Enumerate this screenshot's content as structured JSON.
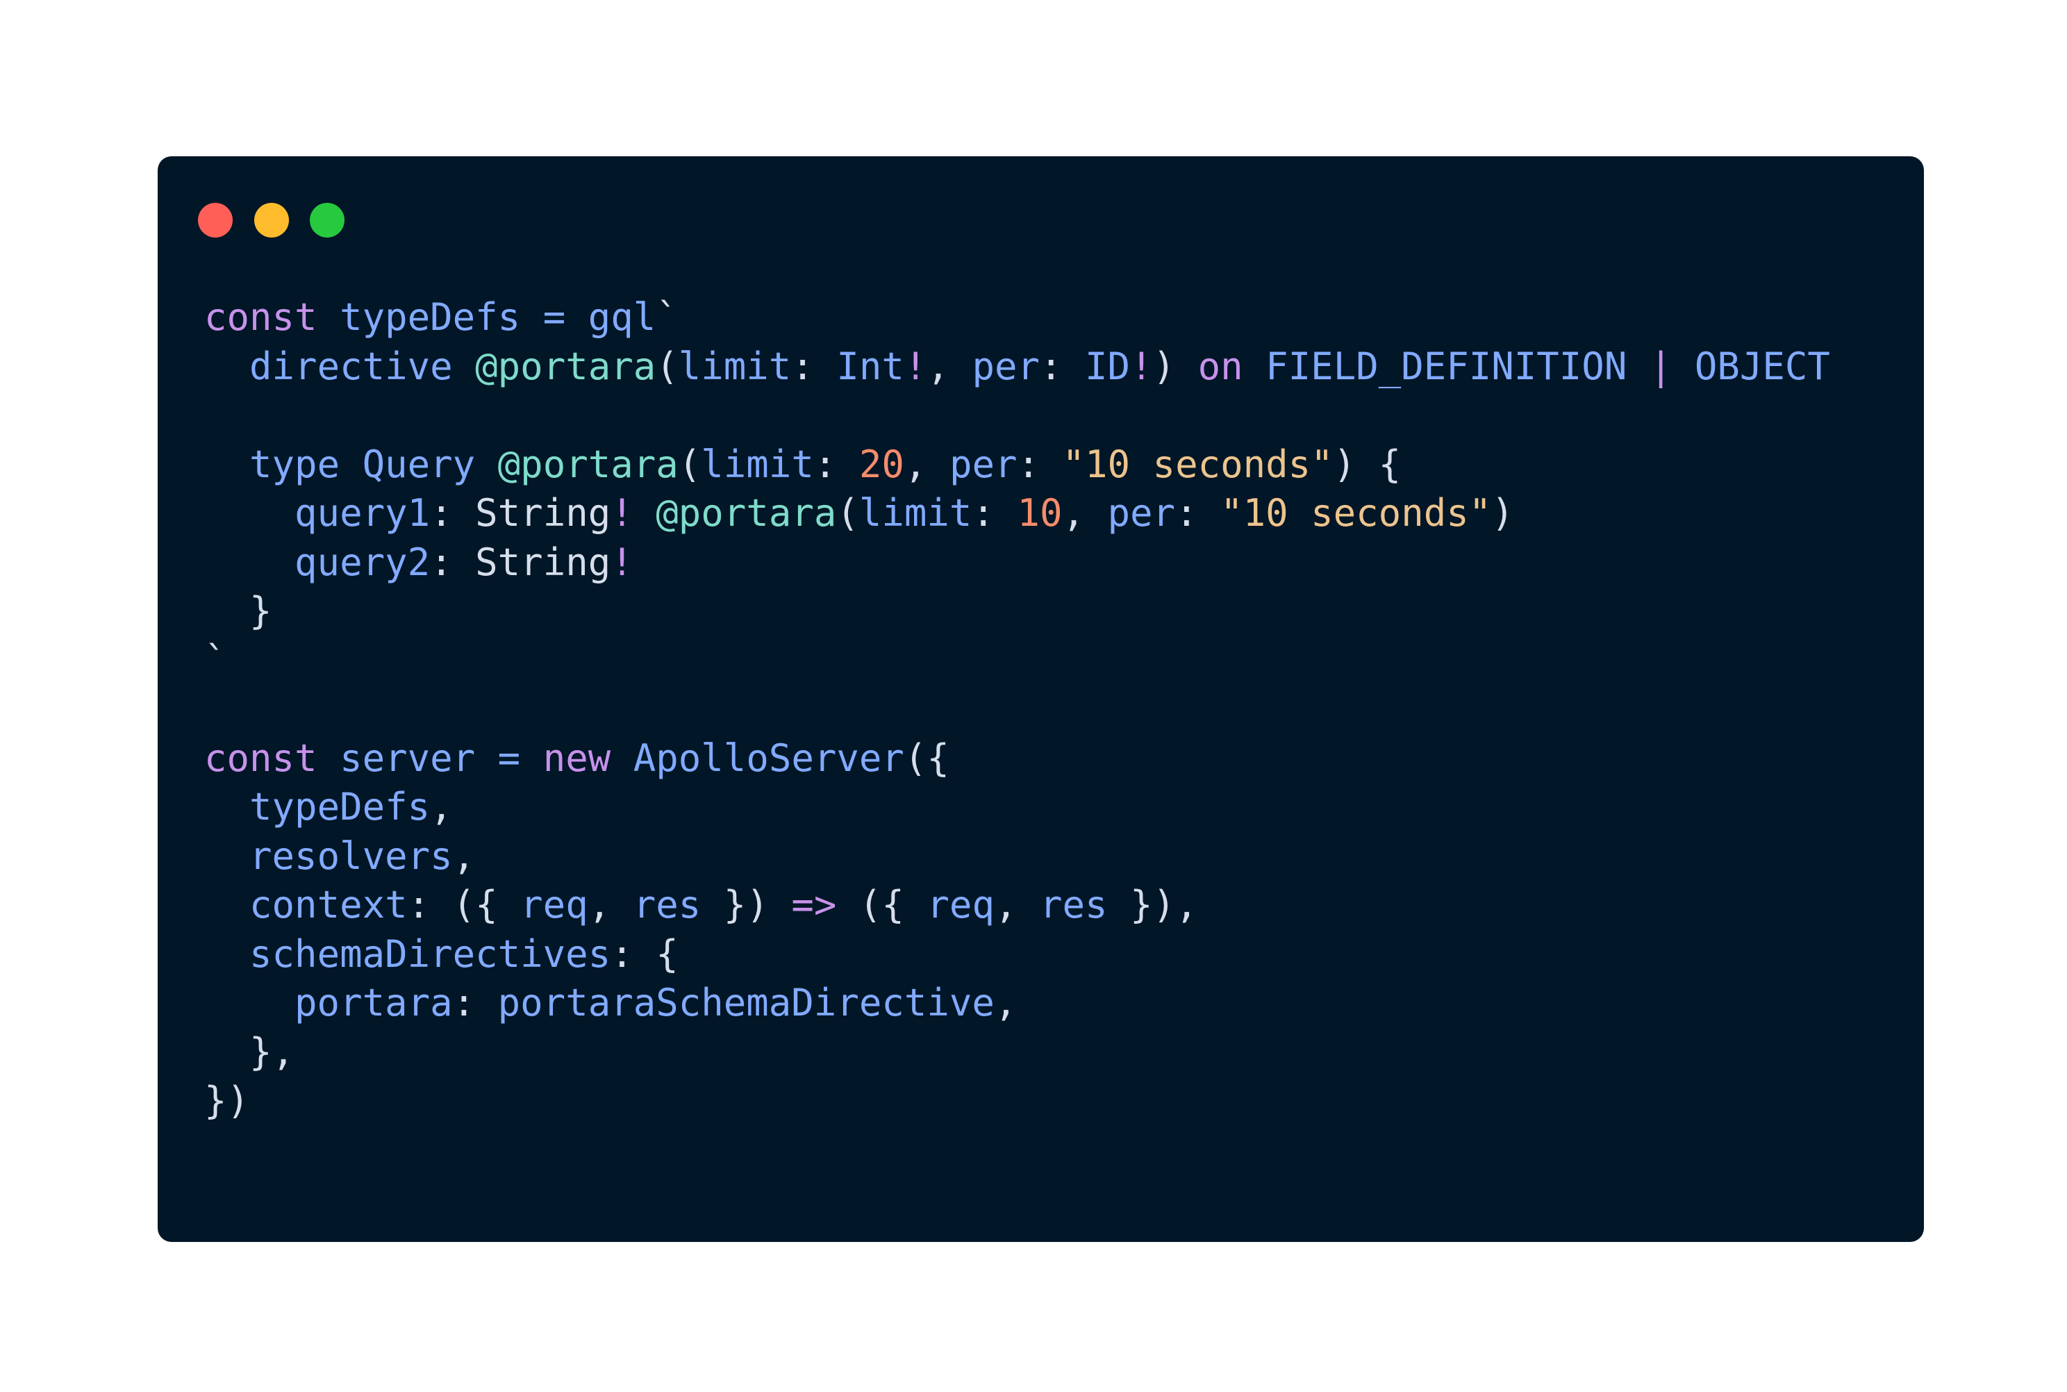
{
  "window": {
    "background": "#011627",
    "controls": [
      {
        "name": "close",
        "color": "#ff5f56"
      },
      {
        "name": "minimize",
        "color": "#ffbd2e"
      },
      {
        "name": "zoom",
        "color": "#27c93f"
      }
    ]
  },
  "theme": {
    "keyword": "#c792ea",
    "identifier": "#82aaff",
    "directive": "#7fdbca",
    "number": "#f78c6c",
    "string": "#ecc48d",
    "punctuation": "#d6deeb",
    "operator": "#c792ea",
    "type": "#d6deeb"
  },
  "code": {
    "language": "javascript",
    "lines": [
      [
        [
          "keyword",
          "const"
        ],
        [
          "punctuation",
          " "
        ],
        [
          "identifier",
          "typeDefs"
        ],
        [
          "punctuation",
          " "
        ],
        [
          "identifier",
          "="
        ],
        [
          "punctuation",
          " "
        ],
        [
          "identifier",
          "gql"
        ],
        [
          "punctuation",
          "`"
        ]
      ],
      [
        [
          "punctuation",
          "  "
        ],
        [
          "identifier",
          "directive"
        ],
        [
          "punctuation",
          " "
        ],
        [
          "directive",
          "@portara"
        ],
        [
          "punctuation",
          "("
        ],
        [
          "identifier",
          "limit"
        ],
        [
          "punctuation",
          ": "
        ],
        [
          "identifier",
          "Int"
        ],
        [
          "operator",
          "!"
        ],
        [
          "punctuation",
          ", "
        ],
        [
          "identifier",
          "per"
        ],
        [
          "punctuation",
          ": "
        ],
        [
          "identifier",
          "ID"
        ],
        [
          "operator",
          "!"
        ],
        [
          "punctuation",
          ") "
        ],
        [
          "keyword",
          "on"
        ],
        [
          "punctuation",
          " "
        ],
        [
          "identifier",
          "FIELD_DEFINITION"
        ],
        [
          "punctuation",
          " "
        ],
        [
          "operator",
          "|"
        ],
        [
          "punctuation",
          " "
        ],
        [
          "identifier",
          "OBJECT"
        ]
      ],
      [],
      [
        [
          "punctuation",
          "  "
        ],
        [
          "identifier",
          "type"
        ],
        [
          "punctuation",
          " "
        ],
        [
          "identifier",
          "Query"
        ],
        [
          "punctuation",
          " "
        ],
        [
          "directive",
          "@portara"
        ],
        [
          "punctuation",
          "("
        ],
        [
          "identifier",
          "limit"
        ],
        [
          "punctuation",
          ": "
        ],
        [
          "number",
          "20"
        ],
        [
          "punctuation",
          ", "
        ],
        [
          "identifier",
          "per"
        ],
        [
          "punctuation",
          ": "
        ],
        [
          "string",
          "\"10 seconds\""
        ],
        [
          "punctuation",
          ") {"
        ]
      ],
      [
        [
          "punctuation",
          "    "
        ],
        [
          "identifier",
          "query1"
        ],
        [
          "punctuation",
          ": "
        ],
        [
          "type",
          "String"
        ],
        [
          "operator",
          "!"
        ],
        [
          "punctuation",
          " "
        ],
        [
          "directive",
          "@portara"
        ],
        [
          "punctuation",
          "("
        ],
        [
          "identifier",
          "limit"
        ],
        [
          "punctuation",
          ": "
        ],
        [
          "number",
          "10"
        ],
        [
          "punctuation",
          ", "
        ],
        [
          "identifier",
          "per"
        ],
        [
          "punctuation",
          ": "
        ],
        [
          "string",
          "\"10 seconds\""
        ],
        [
          "punctuation",
          ")"
        ]
      ],
      [
        [
          "punctuation",
          "    "
        ],
        [
          "identifier",
          "query2"
        ],
        [
          "punctuation",
          ": "
        ],
        [
          "type",
          "String"
        ],
        [
          "operator",
          "!"
        ]
      ],
      [
        [
          "punctuation",
          "  }"
        ]
      ],
      [
        [
          "punctuation",
          "`"
        ]
      ],
      [],
      [
        [
          "keyword",
          "const"
        ],
        [
          "punctuation",
          " "
        ],
        [
          "identifier",
          "server"
        ],
        [
          "punctuation",
          " "
        ],
        [
          "identifier",
          "="
        ],
        [
          "punctuation",
          " "
        ],
        [
          "keyword",
          "new"
        ],
        [
          "punctuation",
          " "
        ],
        [
          "identifier",
          "ApolloServer"
        ],
        [
          "punctuation",
          "({"
        ]
      ],
      [
        [
          "punctuation",
          "  "
        ],
        [
          "identifier",
          "typeDefs"
        ],
        [
          "punctuation",
          ","
        ]
      ],
      [
        [
          "punctuation",
          "  "
        ],
        [
          "identifier",
          "resolvers"
        ],
        [
          "punctuation",
          ","
        ]
      ],
      [
        [
          "punctuation",
          "  "
        ],
        [
          "identifier",
          "context"
        ],
        [
          "punctuation",
          ": ({ "
        ],
        [
          "identifier",
          "req"
        ],
        [
          "punctuation",
          ", "
        ],
        [
          "identifier",
          "res"
        ],
        [
          "punctuation",
          " }) "
        ],
        [
          "operator",
          "=>"
        ],
        [
          "punctuation",
          " ({ "
        ],
        [
          "identifier",
          "req"
        ],
        [
          "punctuation",
          ", "
        ],
        [
          "identifier",
          "res"
        ],
        [
          "punctuation",
          " }),"
        ]
      ],
      [
        [
          "punctuation",
          "  "
        ],
        [
          "identifier",
          "schemaDirectives"
        ],
        [
          "punctuation",
          ": {"
        ]
      ],
      [
        [
          "punctuation",
          "    "
        ],
        [
          "identifier",
          "portara"
        ],
        [
          "punctuation",
          ": "
        ],
        [
          "identifier",
          "portaraSchemaDirective"
        ],
        [
          "punctuation",
          ","
        ]
      ],
      [
        [
          "punctuation",
          "  },"
        ]
      ],
      [
        [
          "punctuation",
          "})"
        ]
      ]
    ]
  }
}
